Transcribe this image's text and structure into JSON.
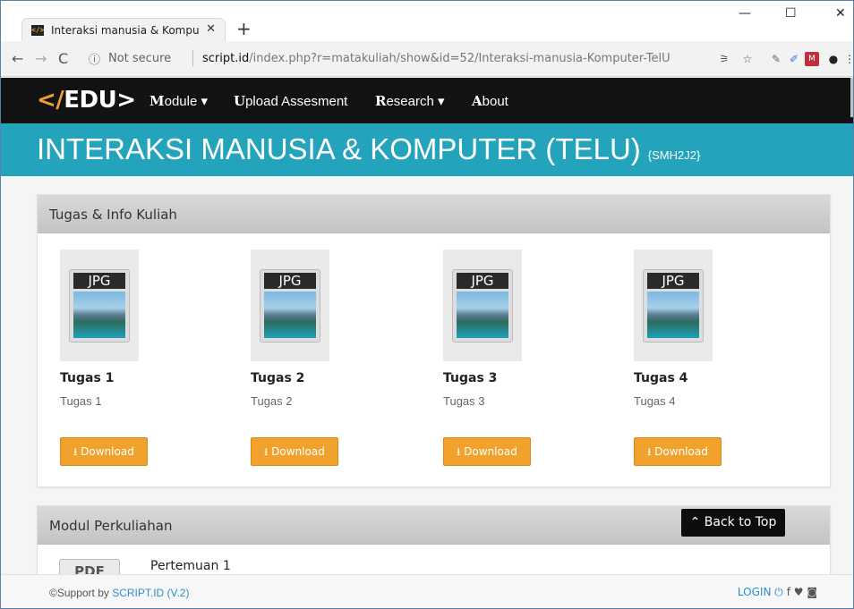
{
  "browser": {
    "tab_title": "Interaksi manusia & Komputer (T",
    "tab_favicon": "</>",
    "tab_close": "✕",
    "new_tab": "+",
    "window_controls": {
      "minimize": "—",
      "maximize": "☐",
      "close": "✕"
    },
    "nav": {
      "back": "←",
      "forward": "→",
      "reload": "C"
    },
    "address": {
      "info_icon": "ⓘ",
      "security": "Not secure",
      "domain": "script.id",
      "path": "/index.php?r=matakuliah/show&id=52/Interaksi-manusia-Komputer-TelU"
    },
    "extensions": [
      "translate-icon",
      "star-icon",
      "eyedropper-icon",
      "pen-icon",
      "ext-red-icon",
      "avatar-icon",
      "menu-icon"
    ],
    "ext_glyphs": {
      "translate": "⚞",
      "star": "☆",
      "eyedropper": "✎",
      "pen": "✐",
      "ext_red": "M",
      "avatar": "●",
      "menu": "⋮"
    }
  },
  "site": {
    "brand_prefix": "</",
    "brand_rest": "EDU>",
    "brand": "</EDU>",
    "nav": [
      {
        "first": "M",
        "rest": "odule ▾"
      },
      {
        "first": "U",
        "rest": "pload Assesment"
      },
      {
        "first": "R",
        "rest": "esearch ▾"
      },
      {
        "first": "A",
        "rest": "bout"
      }
    ]
  },
  "hero": {
    "title": "INTERAKSI MANUSIA & KOMPUTER (TELU)",
    "code": "{SMH2J2}"
  },
  "panels": {
    "tugas": {
      "title": "Tugas & Info Kuliah",
      "items": [
        {
          "file_type": "JPG",
          "title": "Tugas 1",
          "subtitle": "Tugas 1",
          "button": "⭳ Download"
        },
        {
          "file_type": "JPG",
          "title": "Tugas 2",
          "subtitle": "Tugas 2",
          "button": "⭳ Download"
        },
        {
          "file_type": "JPG",
          "title": "Tugas 3",
          "subtitle": "Tugas 3",
          "button": "⭳ Download"
        },
        {
          "file_type": "JPG",
          "title": "Tugas 4",
          "subtitle": "Tugas 4",
          "button": "⭳ Download"
        }
      ]
    },
    "modul": {
      "title": "Modul Perkuliahan",
      "file_type": "PDF",
      "first_item": "Pertemuan 1"
    }
  },
  "back_to_top": "⌃ Back to Top",
  "footer": {
    "support_prefix": "©Support by ",
    "support_link": "SCRIPT.ID (V.2)",
    "login": "LOGIN ⏻",
    "social": "f  ♥  ◙"
  },
  "colors": {
    "navbar": "#121212",
    "hero": "#24a4bc",
    "accent_orange": "#f1a22d",
    "link_blue": "#2a8ec8"
  }
}
